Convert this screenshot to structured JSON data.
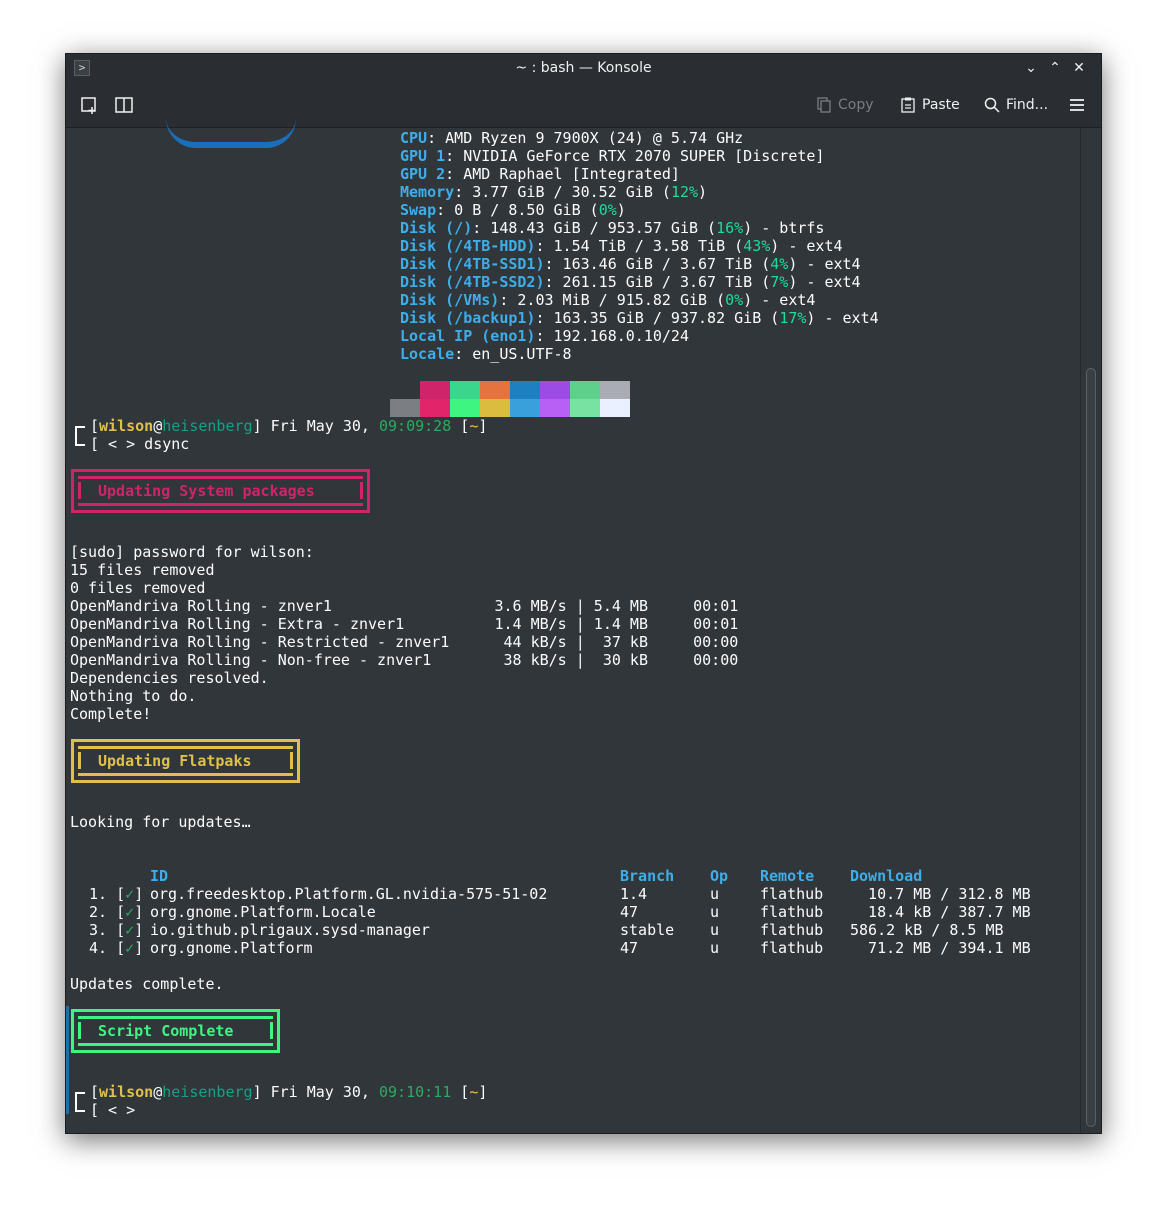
{
  "window": {
    "title": "~ : bash — Konsole",
    "app_icon": ">",
    "controls": {
      "minimize": "⌄",
      "maximize": "⌃",
      "close": "✕"
    }
  },
  "toolbar": {
    "new_tab_icon": "new-tab-icon",
    "split_icon": "split-view-icon",
    "copy": "Copy",
    "paste": "Paste",
    "find": "Find...",
    "menu_icon": "hamburger-menu-icon"
  },
  "fastfetch": {
    "cpu": {
      "key": "CPU",
      "value": ": AMD Ryzen 9 7900X (24) @ 5.74 GHz"
    },
    "gpu1": {
      "key": "GPU 1",
      "value": ": NVIDIA GeForce RTX 2070 SUPER [Discrete]"
    },
    "gpu2": {
      "key": "GPU 2",
      "value": ": AMD Raphael [Integrated]"
    },
    "memory": {
      "key": "Memory",
      "pre": ": 3.77 GiB / 30.52 GiB (",
      "pct": "12%",
      "post": ")"
    },
    "swap": {
      "key": "Swap",
      "pre": ": 0 B / 8.50 GiB (",
      "pct": "0%",
      "post": ")"
    },
    "disk_root": {
      "key": "Disk (/)",
      "pre": ": 148.43 GiB / 953.57 GiB (",
      "pct": "16%",
      "post": ") - btrfs"
    },
    "disk_hdd": {
      "key": "Disk (/4TB-HDD)",
      "pre": ": 1.54 TiB / 3.58 TiB (",
      "pct": "43%",
      "post": ") - ext4"
    },
    "disk_ssd1": {
      "key": "Disk (/4TB-SSD1)",
      "pre": ": 163.46 GiB / 3.67 TiB (",
      "pct": "4%",
      "post": ") - ext4"
    },
    "disk_ssd2": {
      "key": "Disk (/4TB-SSD2)",
      "pre": ": 261.15 GiB / 3.67 TiB (",
      "pct": "7%",
      "post": ") - ext4"
    },
    "disk_vms": {
      "key": "Disk (/VMs)",
      "pre": ": 2.03 MiB / 915.82 GiB (",
      "pct": "0%",
      "post": ") - ext4"
    },
    "disk_backup": {
      "key": "Disk (/backup1)",
      "pre": ": 163.35 GiB / 937.82 GiB (",
      "pct": "17%",
      "post": ") - ext4"
    },
    "local_ip": {
      "key": "Local IP (eno1)",
      "value": ": 192.168.0.10/24"
    },
    "locale": {
      "key": "Locale",
      "value": ": en_US.UTF-8"
    },
    "palette_top": [
      "#31363b",
      "#d0246a",
      "#39d68b",
      "#e4733f",
      "#1d80c0",
      "#9c4be4",
      "#5fd08b",
      "#a9adb3"
    ],
    "palette_bottom": [
      "#7b7f84",
      "#e2246b",
      "#3ff581",
      "#dcbc3f",
      "#3aa0dc",
      "#b85ff5",
      "#78e2a2",
      "#eaf0ff"
    ]
  },
  "prompt1": {
    "open": "[",
    "user": "wilson",
    "at": "@",
    "host": "heisenberg",
    "date": "] Fri May 30, ",
    "time": "09:09:28",
    "dir_open": " [",
    "dir": "~",
    "dir_close": "]",
    "cmd_line": "[ < > dsync"
  },
  "banner_system": "Updating System packages",
  "sys_lines": [
    "[sudo] password for wilson:",
    "15 files removed",
    "0 files removed",
    "OpenMandriva Rolling - znver1                  3.6 MB/s | 5.4 MB     00:01",
    "OpenMandriva Rolling - Extra - znver1          1.4 MB/s | 1.4 MB     00:01",
    "OpenMandriva Rolling - Restricted - znver1      44 kB/s |  37 kB     00:00",
    "OpenMandriva Rolling - Non-free - znver1        38 kB/s |  30 kB     00:00",
    "Dependencies resolved.",
    "Nothing to do.",
    "Complete!"
  ],
  "banner_flatpak": "Updating Flatpaks",
  "looking": "Looking for updates…",
  "flatpak_table": {
    "headers": {
      "id": "ID",
      "branch": "Branch",
      "op": "Op",
      "remote": "Remote",
      "download": "Download"
    },
    "rows": [
      {
        "num": " 1.",
        "check": "✓",
        "id": "org.freedesktop.Platform.GL.nvidia-575-51-02",
        "branch": "1.4",
        "op": "u",
        "remote": "flathub",
        "download": "  10.7 MB / 312.8 MB"
      },
      {
        "num": " 2.",
        "check": "✓",
        "id": "org.gnome.Platform.Locale",
        "branch": "47",
        "op": "u",
        "remote": "flathub",
        "download": "  18.4 kB / 387.7 MB"
      },
      {
        "num": " 3.",
        "check": "✓",
        "id": "io.github.plrigaux.sysd-manager",
        "branch": "stable",
        "op": "u",
        "remote": "flathub",
        "download": "586.2 kB / 8.5 MB"
      },
      {
        "num": " 4.",
        "check": "✓",
        "id": "org.gnome.Platform",
        "branch": "47",
        "op": "u",
        "remote": "flathub",
        "download": "  71.2 MB / 394.1 MB"
      }
    ]
  },
  "updates_complete": "Updates complete.",
  "banner_complete": "Script Complete",
  "prompt2": {
    "open": "[",
    "user": "wilson",
    "at": "@",
    "host": "heisenberg",
    "date": "] Fri May 30, ",
    "time": "09:10:11",
    "dir_open": " [",
    "dir": "~",
    "dir_close": "]",
    "cmd_line": "[ < >"
  },
  "colors": {
    "key": "#3daee9",
    "pct": "#1cdc9a",
    "user": "#fdbc4b",
    "host": "#16a085",
    "magenta_box": "#d0246a",
    "yellow_box": "#e0c04a",
    "green_box": "#3ff581"
  }
}
